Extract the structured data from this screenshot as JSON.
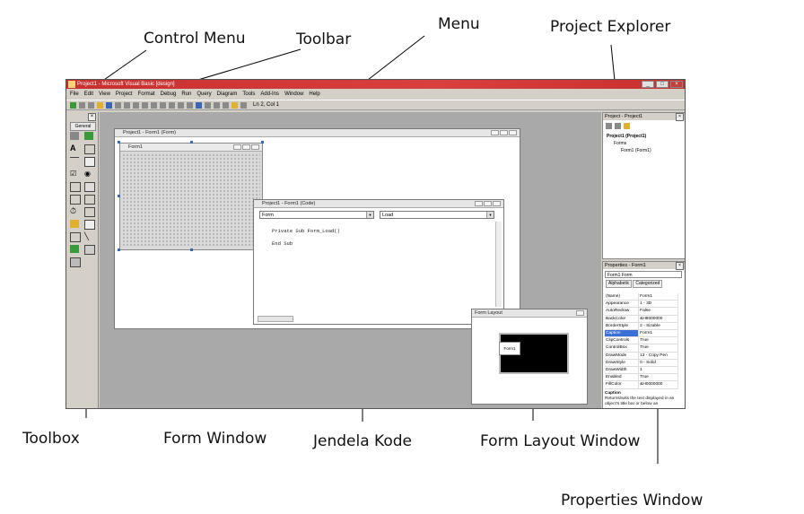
{
  "callouts": {
    "control_menu": "Control Menu",
    "toolbar": "Toolbar",
    "menu": "Menu",
    "project_explorer": "Project Explorer",
    "toolbox": "Toolbox",
    "form_window": "Form Window",
    "jendela_kode": "Jendela Kode",
    "form_layout_window": "Form Layout Window",
    "properties_window": "Properties Window"
  },
  "ide": {
    "title": "Project1 - Microsoft Visual Basic [design]",
    "menu": [
      "File",
      "Edit",
      "View",
      "Project",
      "Format",
      "Debug",
      "Run",
      "Query",
      "Diagram",
      "Tools",
      "Add-Ins",
      "Window",
      "Help"
    ],
    "cursor_pos": "Ln 2, Col 1",
    "toolbox": {
      "close": "×",
      "tab": "General"
    },
    "project_form_window": {
      "title": "Project1 - Form1 (Form)",
      "form_caption": "Form1"
    },
    "code_window": {
      "title": "Project1 - Form1 (Code)",
      "object_combo": "Form",
      "proc_combo": "Load",
      "line1": "Private Sub Form_Load()",
      "line2": "End Sub"
    },
    "form_layout": {
      "title": "Form Layout",
      "mini_form": "Form1"
    },
    "project_explorer": {
      "title": "Project - Project1",
      "root": "Project1 (Project1)",
      "folder": "Forms",
      "item": "Form1 (Form1)"
    },
    "properties": {
      "title": "Properties - Form1",
      "object": "Form1 Form",
      "tabs": [
        "Alphabetic",
        "Categorized"
      ],
      "rows": [
        [
          "(Name)",
          "Form1"
        ],
        [
          "Appearance",
          "1 - 3D"
        ],
        [
          "AutoRedraw",
          "False"
        ],
        [
          "BackColor",
          "&H8000000"
        ],
        [
          "BorderStyle",
          "2 - Sizable"
        ],
        [
          "Caption",
          "Form1"
        ],
        [
          "ClipControls",
          "True"
        ],
        [
          "ControlBox",
          "True"
        ],
        [
          "DrawMode",
          "13 - Copy Pen"
        ],
        [
          "DrawStyle",
          "0 - Solid"
        ],
        [
          "DrawWidth",
          "1"
        ],
        [
          "Enabled",
          "True"
        ],
        [
          "FillColor",
          "&H0000000"
        ]
      ],
      "selected_row": 5,
      "desc_title": "Caption",
      "desc_text": "Returns/sets the text displayed in an object's title bar or below an"
    }
  }
}
